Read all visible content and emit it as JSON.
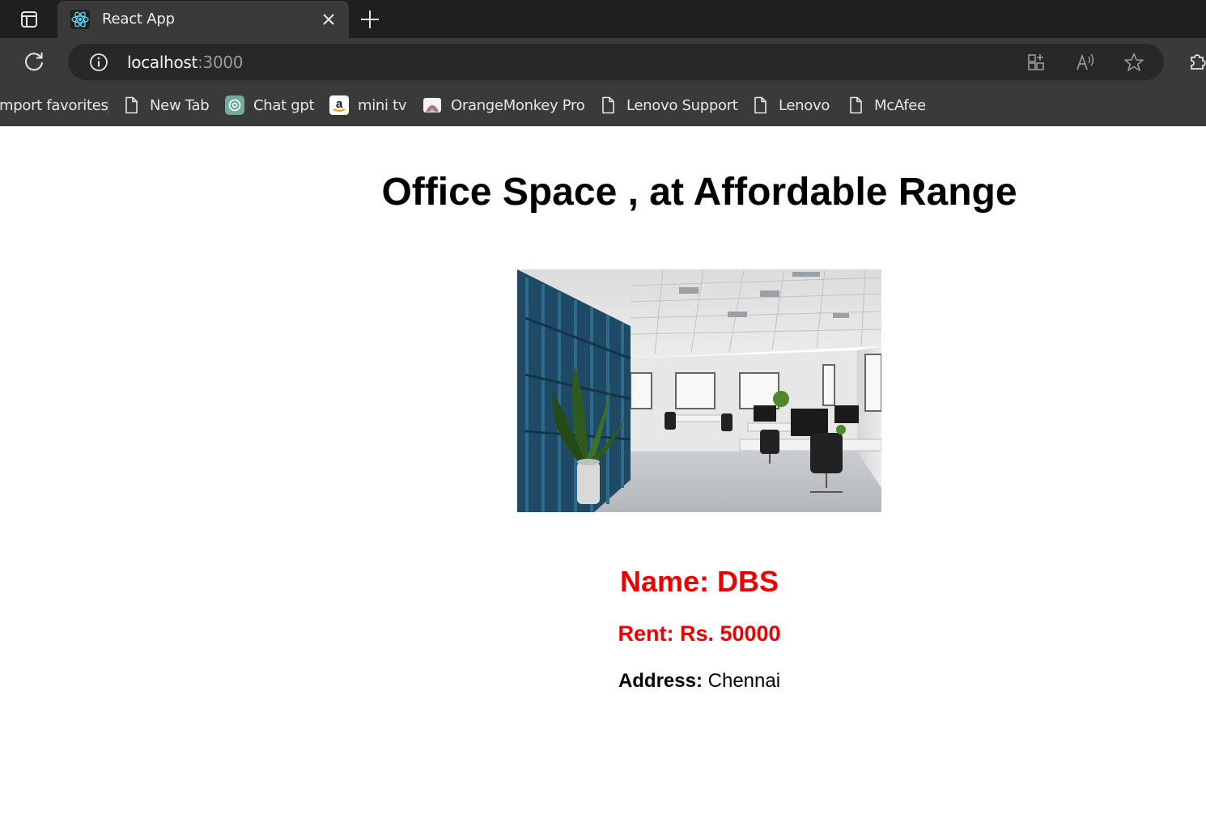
{
  "browser": {
    "tab": {
      "title": "React App"
    },
    "address_bar": {
      "host": "localhost",
      "port": ":3000"
    },
    "bookmarks": [
      {
        "label": "Import favorites",
        "visible_label": "mport favorites",
        "icon": "none"
      },
      {
        "label": "New Tab",
        "icon": "page-icon"
      },
      {
        "label": "Chat gpt",
        "icon": "chatgpt-icon"
      },
      {
        "label": "mini tv",
        "icon": "amazon-icon"
      },
      {
        "label": "OrangeMonkey Pro",
        "icon": "orangemonkey-icon"
      },
      {
        "label": "Lenovo Support",
        "icon": "page-icon"
      },
      {
        "label": "Lenovo",
        "icon": "page-icon"
      },
      {
        "label": "McAfee",
        "icon": "page-icon"
      }
    ]
  },
  "page": {
    "heading": "Office Space , at Affordable Range",
    "image_icon": "office-interior-photo",
    "name_text": "Name: DBS",
    "rent_text": "Rent: Rs. 50000",
    "address_label": "Address:",
    "address_value": "Chennai"
  },
  "colors": {
    "name_rent": "#ee0000",
    "chrome_dark": "#1f1f1f",
    "chrome_mid": "#3a3a3a"
  }
}
